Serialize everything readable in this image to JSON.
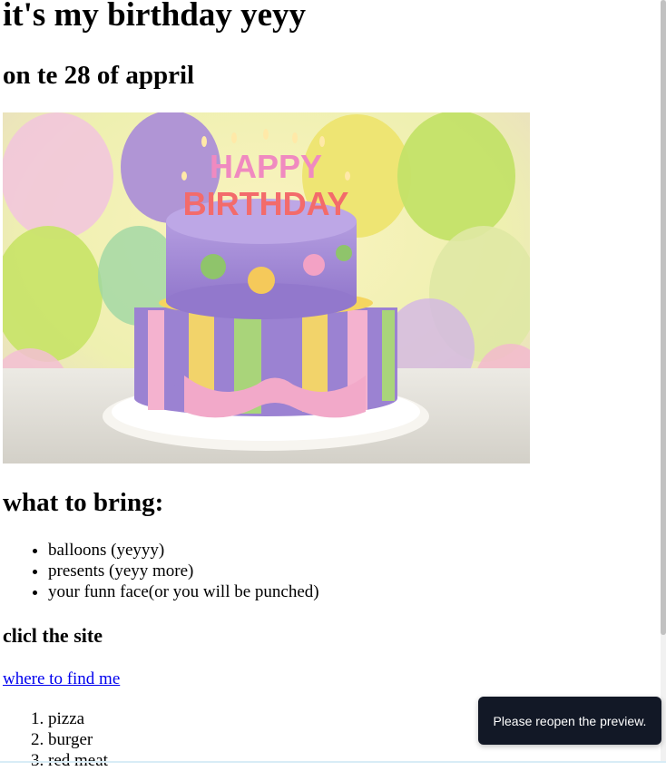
{
  "page": {
    "title": "it's my birthday yeyy",
    "subtitle": "on te 28 of appril"
  },
  "image": {
    "alt": "birthday cake",
    "cake_text": "HAPPY BIRTHDAY",
    "colors": {
      "cake_top": "#a98bd6",
      "cake_bottom": "#9a7fd0",
      "ribbon": "#f2a9c9",
      "dots": [
        "#8fc46b",
        "#f5c95a",
        "#f3a2c5"
      ],
      "background": "#f4eaa6"
    }
  },
  "bring": {
    "heading": "what to bring:",
    "items": [
      "balloons (yeyyy)",
      "presents (yeyy more)",
      "your funn face(or you will be punched)"
    ]
  },
  "site": {
    "heading": "clicl the site",
    "link_text": "where to find me"
  },
  "food": {
    "items": [
      "pizza",
      "burger",
      "red meat"
    ]
  },
  "toast": {
    "message": "Please reopen the preview."
  }
}
